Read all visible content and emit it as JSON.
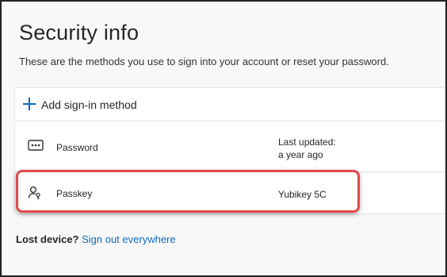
{
  "page": {
    "title": "Security info",
    "subtitle": "These are the methods you use to sign into your account or reset your password."
  },
  "add_method": {
    "label": "Add sign-in method",
    "icon": "plus-icon",
    "accent_color": "#0f6cbd"
  },
  "methods": [
    {
      "name": "Password",
      "icon": "password-dots-icon",
      "detail_label": "Last updated:",
      "detail_value": "a year ago"
    },
    {
      "name": "Passkey",
      "icon": "passkey-person-key-icon",
      "detail_value": "Yubikey 5C",
      "highlighted": true,
      "highlight_color": "#e04a4a"
    }
  ],
  "footer": {
    "lost_text": "Lost device?",
    "link_text": "Sign out everywhere"
  }
}
